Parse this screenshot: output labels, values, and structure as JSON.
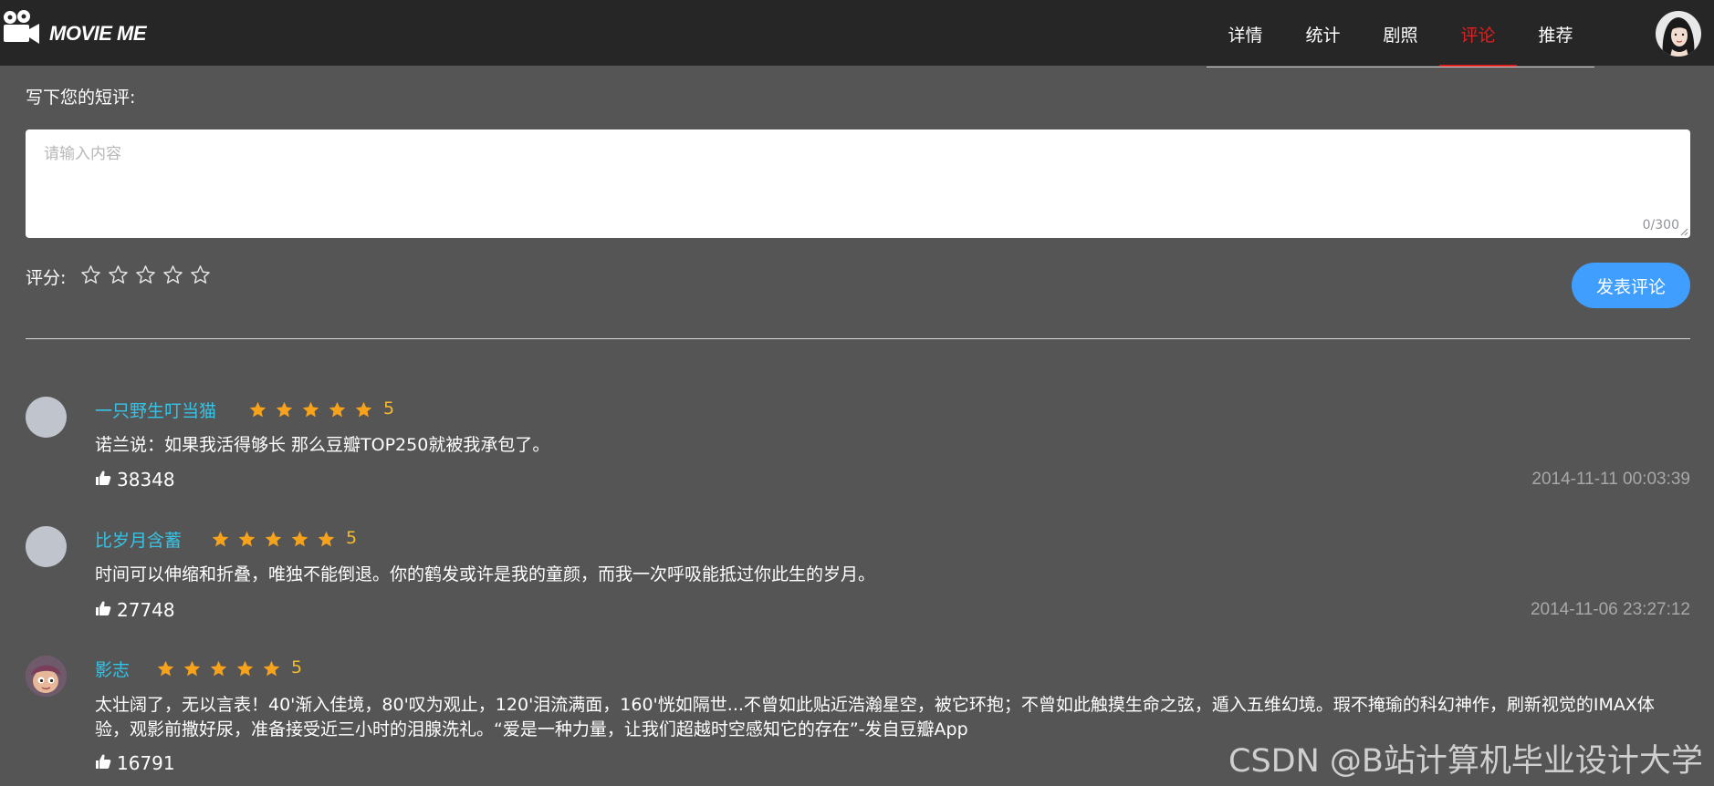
{
  "header": {
    "logo_text": "MOVIE ME",
    "nav": [
      {
        "label": "详情",
        "active": false
      },
      {
        "label": "统计",
        "active": false
      },
      {
        "label": "剧照",
        "active": false
      },
      {
        "label": "评论",
        "active": true
      },
      {
        "label": "推荐",
        "active": false
      }
    ],
    "accent_color": "#e02020"
  },
  "write": {
    "label": "写下您的短评:",
    "placeholder": "请输入内容",
    "char_count": "0/300",
    "rate_label": "评分:",
    "rating": 0,
    "max_rating": 5,
    "submit_label": "发表评论",
    "button_color": "#409eff"
  },
  "comments": [
    {
      "user": "一只野生叮当猫",
      "rating": 5,
      "score": "5",
      "text": "诺兰说：如果我活得够长 那么豆瓣TOP250就被我承包了。",
      "likes": "38348",
      "time": "2014-11-11 00:03:39",
      "avatar": "default"
    },
    {
      "user": "比岁月含蓄",
      "rating": 5,
      "score": "5",
      "text": "时间可以伸缩和折叠，唯独不能倒退。你的鹤发或许是我的童颜，而我一次呼吸能抵过你此生的岁月。",
      "likes": "27748",
      "time": "2014-11-06 23:27:12",
      "avatar": "default"
    },
    {
      "user": "影志",
      "rating": 5,
      "score": "5",
      "text": "太壮阔了，无以言表！40'渐入佳境，80'叹为观止，120'泪流满面，160'恍如隔世...不曾如此贴近浩瀚星空，被它环抱；不曾如此触摸生命之弦，遁入五维幻境。瑕不掩瑜的科幻神作，刷新视觉的IMAX体验，观影前撒好尿，准备接受近三小时的泪腺洗礼。“爱是一种力量，让我们超越时空感知它的存在”-发自豆瓣App",
      "likes": "16791",
      "time": "",
      "avatar": "cartoon"
    }
  ],
  "watermark": "CSDN @B站计算机毕业设计大学"
}
